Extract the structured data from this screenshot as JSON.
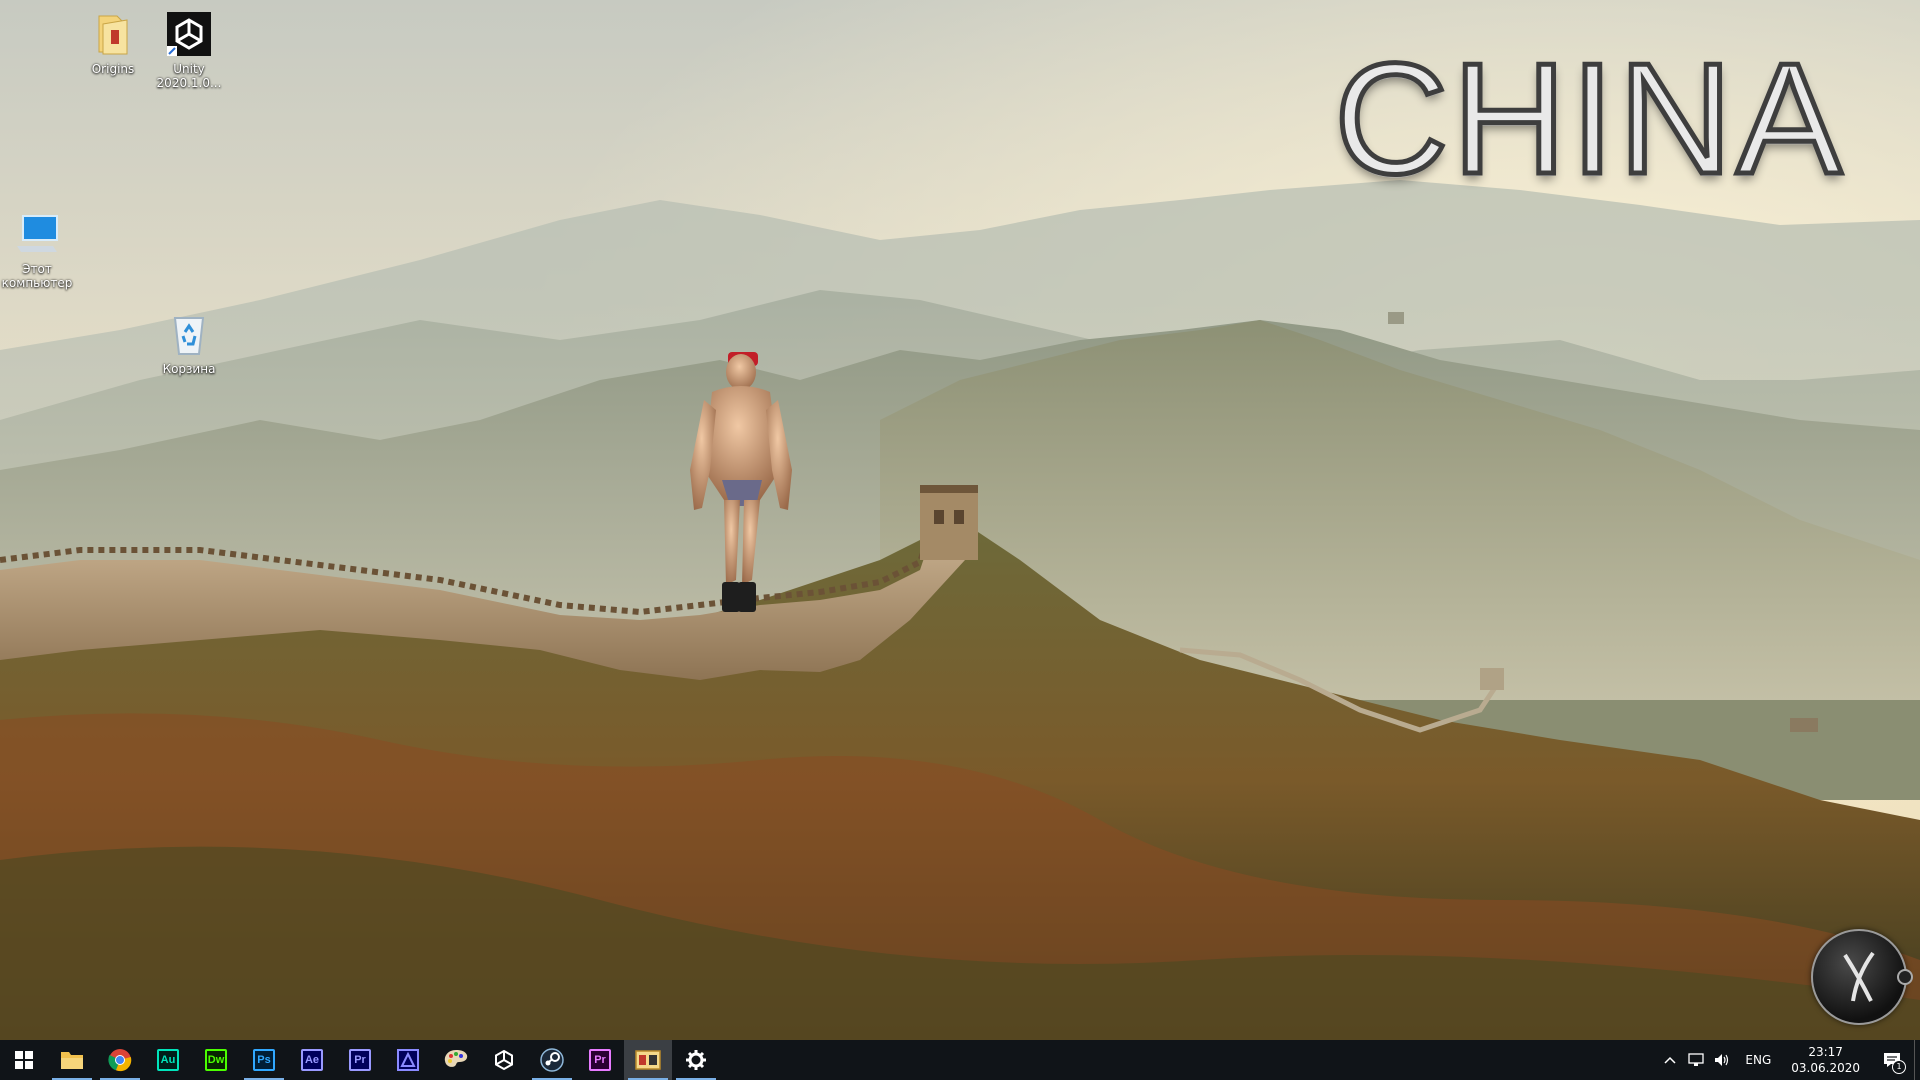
{
  "wallpaper": {
    "title": "CHINA",
    "scene": "great-wall-mountains"
  },
  "desktop": {
    "icons": [
      {
        "label": "Origins",
        "icon": "folder-icon"
      },
      {
        "label": "Unity 2020.1.0...",
        "icon": "unity-icon"
      },
      {
        "label": "Этот компьютер",
        "icon": "computer-icon"
      },
      {
        "label": "Корзина",
        "icon": "recycle-bin-icon"
      }
    ]
  },
  "taskbar": {
    "apps": [
      {
        "name": "start",
        "icon": "windows-icon"
      },
      {
        "name": "file-explorer",
        "icon": "folder-icon"
      },
      {
        "name": "chrome",
        "icon": "chrome-icon"
      },
      {
        "name": "audition",
        "abbr": "Au",
        "color": "#00e4bb",
        "bg": "#001e1a"
      },
      {
        "name": "dreamweaver",
        "abbr": "Dw",
        "color": "#4bff00",
        "bg": "#072401"
      },
      {
        "name": "photoshop",
        "abbr": "Ps",
        "color": "#31a8ff",
        "bg": "#001e36"
      },
      {
        "name": "after-effects",
        "abbr": "Ae",
        "color": "#9999ff",
        "bg": "#00005b"
      },
      {
        "name": "premiere",
        "abbr": "Pr",
        "color": "#9999ff",
        "bg": "#00005b"
      },
      {
        "name": "adobe-media-encoder",
        "icon": "media-encoder-icon"
      },
      {
        "name": "paint",
        "icon": "palette-icon"
      },
      {
        "name": "unity",
        "icon": "unity-icon"
      },
      {
        "name": "steam",
        "icon": "steam-icon"
      },
      {
        "name": "premiere-2",
        "abbr": "Pr",
        "color": "#e77bff",
        "bg": "#2a0033"
      },
      {
        "name": "media-player",
        "icon": "player-icon"
      },
      {
        "name": "settings",
        "icon": "gear-icon"
      }
    ],
    "tray": {
      "language": "ENG",
      "time": "23:17",
      "date": "03.06.2020",
      "notifications": "1"
    }
  },
  "colors": {
    "taskbar_bg": "#101418",
    "accent": "#7ab0e6"
  }
}
